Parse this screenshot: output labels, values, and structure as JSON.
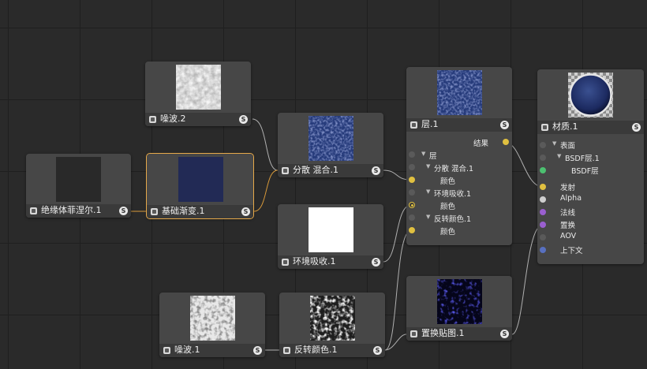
{
  "colors": {
    "canvas_bg": "#2a2a2a",
    "node_bg": "#474747",
    "wire": "#b0b0b0",
    "wire_selected": "#d99a3a",
    "selection_outline": "#e6a94a",
    "port_yellow": "#e0c040",
    "port_purple": "#9a5fd0",
    "port_green": "#4cc070",
    "port_blue": "#5870c0"
  },
  "nodes": {
    "noise2": {
      "label": "噪波.2",
      "icon": "node-icon",
      "badge": "S"
    },
    "fresnel": {
      "label": "绝缘体菲涅尔.1",
      "icon": "node-icon",
      "badge": "S"
    },
    "gradient": {
      "label": "基础渐变.1",
      "icon": "node-icon",
      "badge": "S",
      "selected": true
    },
    "scatter_mix": {
      "label": "分散 混合.1",
      "icon": "node-icon",
      "badge": "S"
    },
    "ao": {
      "label": "环境吸收.1",
      "icon": "node-icon",
      "badge": "S"
    },
    "noise1": {
      "label": "噪波.1",
      "icon": "node-icon",
      "badge": "S"
    },
    "invert": {
      "label": "反转颜色.1",
      "icon": "node-icon",
      "badge": "S"
    },
    "displace": {
      "label": "置换贴图.1",
      "icon": "node-icon",
      "badge": "S"
    },
    "layer": {
      "label": "层.1",
      "icon": "node-icon",
      "badge": "S",
      "output": "结果",
      "inputs": {
        "layer": "层",
        "scatter_group": "分散 混合.1",
        "scatter_color": "颜色",
        "ao_group": "环境吸收.1",
        "ao_color": "颜色",
        "invert_group": "反转颜色.1",
        "invert_color": "颜色"
      }
    },
    "material": {
      "label": "材质.1",
      "icon": "node-icon",
      "badge": "S",
      "inputs": {
        "surface": "表面",
        "bsdf_layer": "BSDF层.1",
        "bsdf": "BSDF层",
        "emission": "发射",
        "alpha": "Alpha",
        "normal": "法线",
        "displacement": "置换",
        "aov": "AOV",
        "context": "上下文"
      }
    }
  }
}
